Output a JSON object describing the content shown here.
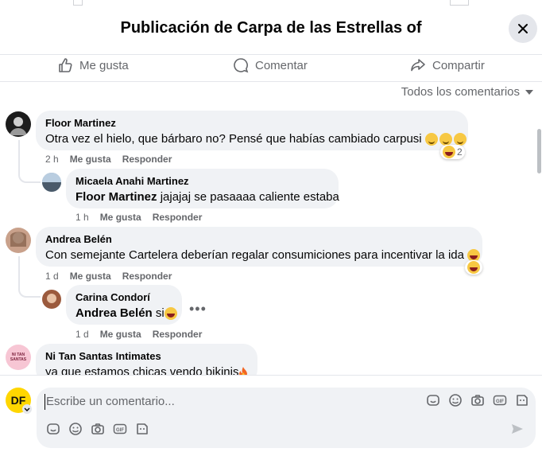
{
  "header": {
    "title": "Publicación de Carpa de las Estrellas of"
  },
  "actions": {
    "like": "Me gusta",
    "comment": "Comentar",
    "share": "Compartir"
  },
  "filter": {
    "label": "Todos los comentarios"
  },
  "comments": [
    {
      "author": "Floor Martinez",
      "text": "Otra vez el hielo, que bárbaro no? Pensé que habías cambiado carpusi",
      "time": "2 h",
      "like": "Me gusta",
      "reply": "Responder",
      "reaction_count": "2",
      "reply_item": {
        "author": "Micaela Anahi Martinez",
        "mention": "Floor Martinez",
        "text": "jajajaj se pasaaaa caliente estaba",
        "time": "1 h",
        "like": "Me gusta",
        "reply": "Responder"
      }
    },
    {
      "author": "Andrea Belén",
      "text": "Con semejante Cartelera deberían regalar consumiciones para incentivar la ida",
      "time": "1 d",
      "like": "Me gusta",
      "reply": "Responder",
      "reply_item": {
        "author": "Carina Condorí",
        "mention": "Andrea Belén",
        "text": "si",
        "time": "1 d",
        "like": "Me gusta",
        "reply": "Responder"
      }
    },
    {
      "author": "Ni Tan Santas Intimates",
      "text": "ya que estamos chicas vendo bikinis",
      "avatar_text": "NI TAN SANTAS"
    }
  ],
  "composer": {
    "placeholder": "Escribe un comentario...",
    "avatar_text": "DF"
  },
  "colors": {
    "bubble": "#f0f2f5",
    "meta": "#65676b",
    "divider": "#e4e6eb"
  },
  "icons": [
    "like-icon",
    "comment-icon",
    "share-icon",
    "close-icon",
    "dropdown-caret-icon",
    "avatar-icon",
    "sticker-icon",
    "emoji-icon",
    "camera-icon",
    "gif-icon",
    "sticker-alt-icon",
    "send-icon"
  ]
}
